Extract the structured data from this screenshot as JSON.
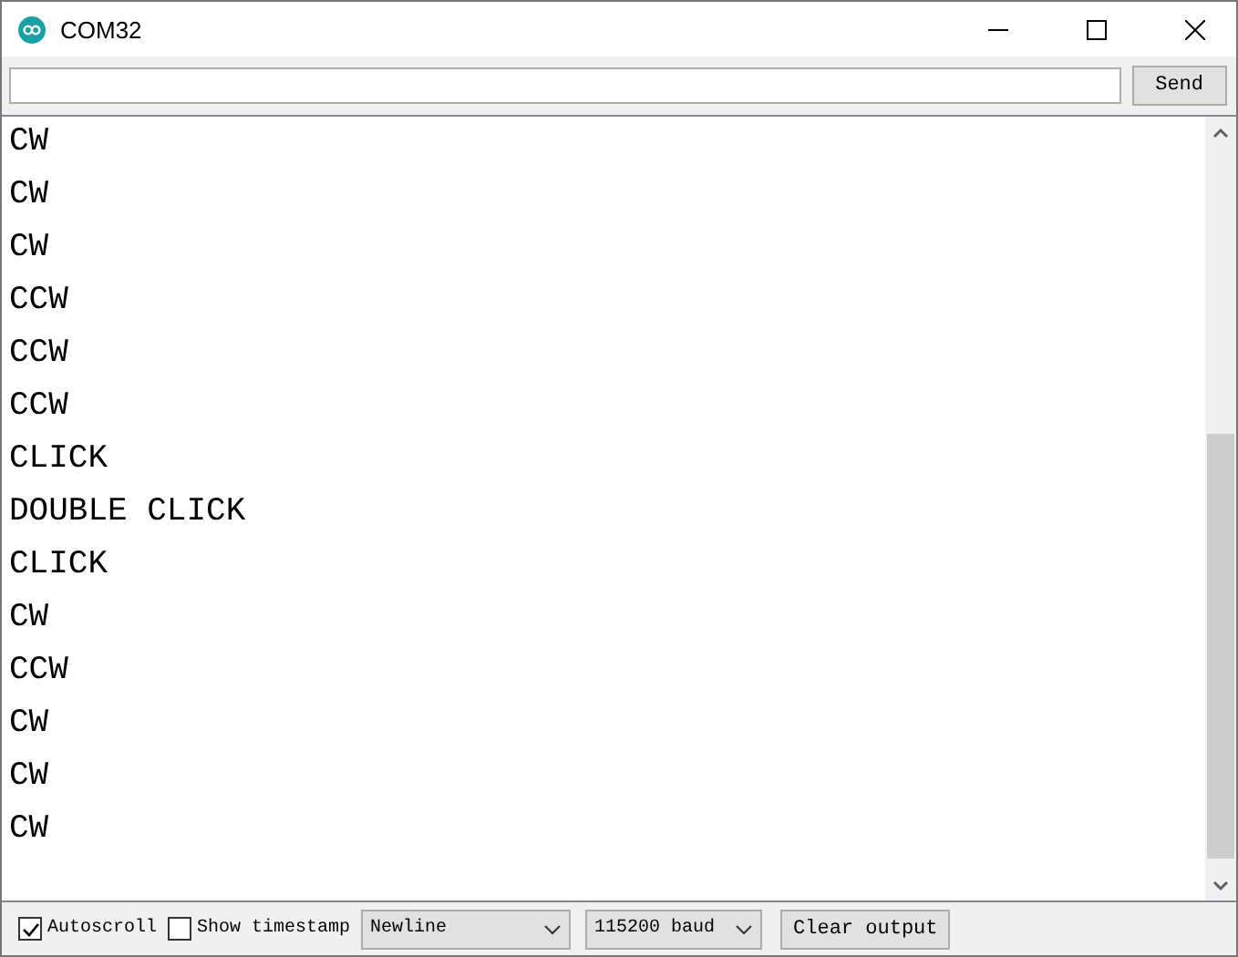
{
  "window": {
    "title": "COM32"
  },
  "send_button": "Send",
  "output_lines": [
    "CW",
    "CW",
    "CW",
    "CCW",
    "CCW",
    "CCW",
    "CLICK",
    "DOUBLE CLICK",
    "CLICK",
    "CW",
    "CCW",
    "CW",
    "CW",
    "CW"
  ],
  "options": [
    {
      "label": "Autoscroll",
      "checked": true
    },
    {
      "label": "Show timestamp",
      "checked": false
    }
  ],
  "line_ending": "Newline",
  "baud": "115200 baud",
  "clear_button": "Clear output"
}
